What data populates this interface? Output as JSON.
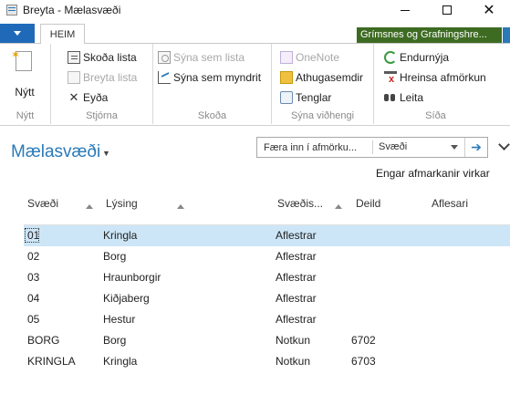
{
  "window": {
    "title": "Breyta - Mælasvæði"
  },
  "ribbon": {
    "tab": "HEIM",
    "company": "Grímsnes og Grafningshre...",
    "groups": [
      {
        "label": "Nýtt",
        "items": [
          {
            "label": "Nýtt",
            "enabled": true
          }
        ]
      },
      {
        "label": "Stjórna",
        "items": [
          {
            "label": "Skoða lista",
            "enabled": true
          },
          {
            "label": "Breyta lista",
            "enabled": false
          },
          {
            "label": "Eyða",
            "enabled": true
          }
        ]
      },
      {
        "label": "Skoða",
        "items": [
          {
            "label": "Sýna sem lista",
            "enabled": false
          },
          {
            "label": "Sýna sem myndrit",
            "enabled": true
          }
        ]
      },
      {
        "label": "Sýna viðhengi",
        "items": [
          {
            "label": "OneNote",
            "enabled": false
          },
          {
            "label": "Athugasemdir",
            "enabled": true
          },
          {
            "label": "Tenglar",
            "enabled": true
          }
        ]
      },
      {
        "label": "Síða",
        "items": [
          {
            "label": "Endurnýja",
            "enabled": true
          },
          {
            "label": "Hreinsa afmörkun",
            "enabled": true
          },
          {
            "label": "Leita",
            "enabled": true
          }
        ]
      }
    ]
  },
  "page": {
    "title": "Mælasvæði",
    "filter": {
      "placeholder": "Færa inn í afmörku...",
      "field": "Svæði",
      "status": "Engar afmarkanir virkar"
    }
  },
  "table": {
    "columns": [
      "Svæði",
      "Lýsing",
      "Svæðis...",
      "Deild",
      "Aflesari"
    ],
    "rows": [
      [
        "01",
        "Kringla",
        "Aflestrar",
        "",
        ""
      ],
      [
        "02",
        "Borg",
        "Aflestrar",
        "",
        ""
      ],
      [
        "03",
        "Hraunborgir",
        "Aflestrar",
        "",
        ""
      ],
      [
        "04",
        "Kiðjaberg",
        "Aflestrar",
        "",
        ""
      ],
      [
        "05",
        "Hestur",
        "Aflestrar",
        "",
        ""
      ],
      [
        "BORG",
        "Borg",
        "Notkun",
        "6702",
        ""
      ],
      [
        "KRINGLA",
        "Kringla",
        "Notkun",
        "6703",
        ""
      ]
    ],
    "selected_row": 0
  },
  "colors": {
    "accent": "#2a7ab8",
    "company_badge": "#3d6b22",
    "selected_row": "#cde6f7"
  }
}
